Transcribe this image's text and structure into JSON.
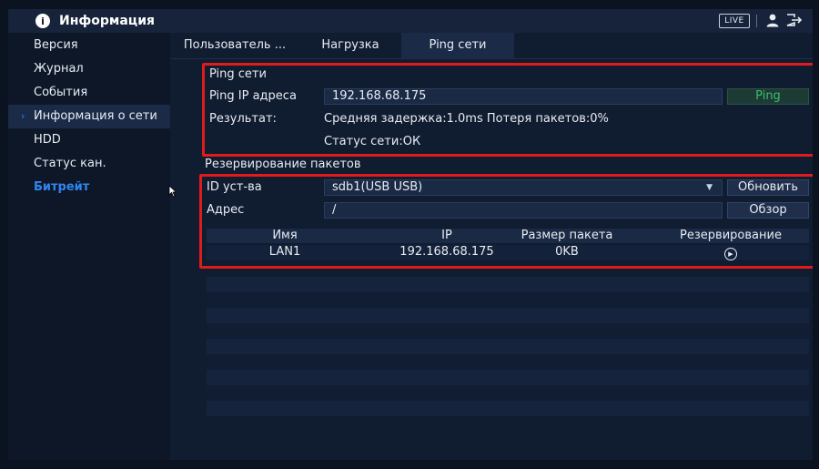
{
  "header": {
    "title": "Информация",
    "live_label": "LIVE"
  },
  "sidebar": {
    "items": [
      {
        "label": "Версия"
      },
      {
        "label": "Журнал"
      },
      {
        "label": "События"
      },
      {
        "label": "Информация о сети"
      },
      {
        "label": "HDD"
      },
      {
        "label": "Статус кан."
      },
      {
        "label": "Битрейт"
      }
    ]
  },
  "tabs": [
    {
      "label": "Пользователь ..."
    },
    {
      "label": "Нагрузка"
    },
    {
      "label": "Ping сети"
    }
  ],
  "ping": {
    "section_title": "Ping сети",
    "ip_label": "Ping IP адреса",
    "ip_value": "192.168.68.175",
    "button": "Ping",
    "result_label": "Результат:",
    "result_line1": "Средняя задержка:1.0ms  Потеря пакетов:0%",
    "result_line2": "Статус сети:ОК"
  },
  "backup": {
    "section_title": "Резервирование пакетов",
    "device_label": "ID уст-ва",
    "device_value": "sdb1(USB USB)",
    "refresh_button": "Обновить",
    "address_label": "Адрес",
    "address_value": "/",
    "browse_button": "Обзор",
    "columns": [
      "Имя",
      "IP",
      "Размер пакета",
      "Резервирование"
    ],
    "rows": [
      {
        "name": "LAN1",
        "ip": "192.168.68.175",
        "size": "0KB",
        "action_icon": "play-circle-icon"
      }
    ]
  },
  "colors": {
    "accent": "#2f86f0",
    "highlight_box": "#e01b1b",
    "ping_button_text": "#3bbf6a"
  }
}
